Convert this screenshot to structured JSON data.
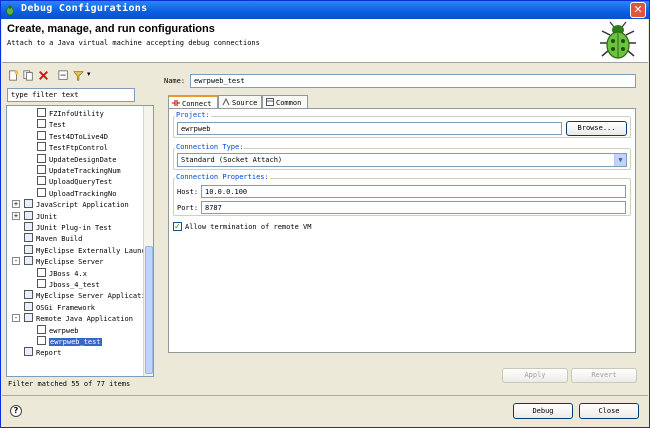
{
  "window": {
    "title": "Debug Configurations"
  },
  "header": {
    "title": "Create, manage, and run configurations",
    "description": "Attach to a Java virtual machine accepting debug connections"
  },
  "left_panel": {
    "filter_value": "type filter text",
    "tree": [
      {
        "label": "FZInfoUtility",
        "level": 2
      },
      {
        "label": "Test",
        "level": 2
      },
      {
        "label": "Test4DToLive4D",
        "level": 2
      },
      {
        "label": "TestFtpControl",
        "level": 2
      },
      {
        "label": "UpdateDesignDate",
        "level": 2
      },
      {
        "label": "UpdateTrackingNum",
        "level": 2
      },
      {
        "label": "UploadQueryTest",
        "level": 2
      },
      {
        "label": "UploadTrackingNo",
        "level": 2
      },
      {
        "label": "JavaScript Application",
        "level": 1,
        "expander": "+"
      },
      {
        "label": "JUnit",
        "level": 1,
        "expander": "+"
      },
      {
        "label": "JUnit Plug-in Test",
        "level": 1
      },
      {
        "label": "Maven Build",
        "level": 1
      },
      {
        "label": "MyEclipse Externally Launc",
        "level": 1
      },
      {
        "label": "MyEclipse Server",
        "level": 1,
        "expander": "-"
      },
      {
        "label": "JBoss  4.x",
        "level": 2
      },
      {
        "label": "Jboss_4_test",
        "level": 2
      },
      {
        "label": "MyEclipse Server Applicati",
        "level": 1
      },
      {
        "label": "OSGi Framework",
        "level": 1
      },
      {
        "label": "Remote Java Application",
        "level": 1,
        "expander": "-"
      },
      {
        "label": "ewrpweb",
        "level": 2
      },
      {
        "label": "ewrpweb_test",
        "level": 2,
        "selected": true
      },
      {
        "label": "Report",
        "level": 1
      }
    ],
    "status": "Filter matched 55 of 77 items"
  },
  "config": {
    "name_label": "Name:",
    "name_value": "ewrpweb_test",
    "tabs": [
      {
        "label": "Connect",
        "active": true
      },
      {
        "label": "Source"
      },
      {
        "label": "Common"
      }
    ],
    "project_label": "Project:",
    "project_value": "ewrpweb",
    "browse_label": "Browse...",
    "connection_type_label": "Connection Type:",
    "connection_type_value": "Standard (Socket Attach)",
    "connection_props_label": "Connection Properties:",
    "host_label": "Host:",
    "host_value": "10.0.0.100",
    "port_label": "Port:",
    "port_value": "8787",
    "allow_termination_label": "Allow termination of remote VM",
    "allow_termination_checked": true,
    "apply_label": "Apply",
    "revert_label": "Revert"
  },
  "footer": {
    "debug_label": "Debug",
    "close_label": "Close"
  },
  "colors": {
    "title_bar": "#0a5ee0",
    "selection": "#316ac5",
    "group_label": "#0046d5"
  }
}
